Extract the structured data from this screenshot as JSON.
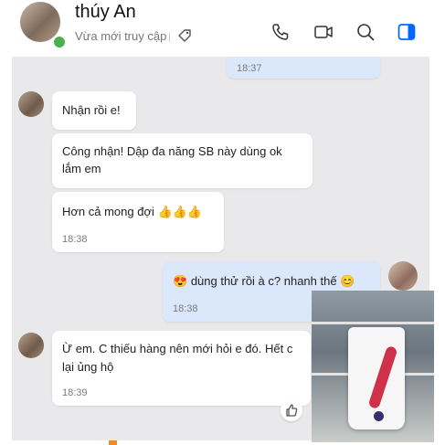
{
  "header": {
    "name": "thúy An",
    "status": "Vừa mới truy cập",
    "separator": "|"
  },
  "messages": [
    {
      "time": "18:37"
    },
    {
      "text": "Nhận rồi e!"
    },
    {
      "text_lines": [
        "Công nhận! Dập đa năng SB này dùng ok",
        "lắm em"
      ]
    },
    {
      "text": "Hơn cả mong đợi",
      "emoji": "👍👍👍",
      "time": "18:38"
    },
    {
      "emoji": "😍",
      "text": "dùng thử rồi à c? nhanh thế",
      "emoji_end": "😊",
      "time": "18:38"
    },
    {
      "text_lines": [
        "Ừ em. C thiếu hàng nên mới hỏi e đó. Hết c",
        "lại ủng hộ"
      ],
      "time": "18:39"
    }
  ],
  "icons": [
    "phone-icon",
    "video-icon",
    "search-icon",
    "sidebar-toggle-icon",
    "tag-icon",
    "like-icon"
  ],
  "colors": {
    "chat_bg": "#e9e8ea",
    "my_bubble": "#dbe8fb",
    "accent": "#0068ff",
    "online": "#4caf50"
  }
}
